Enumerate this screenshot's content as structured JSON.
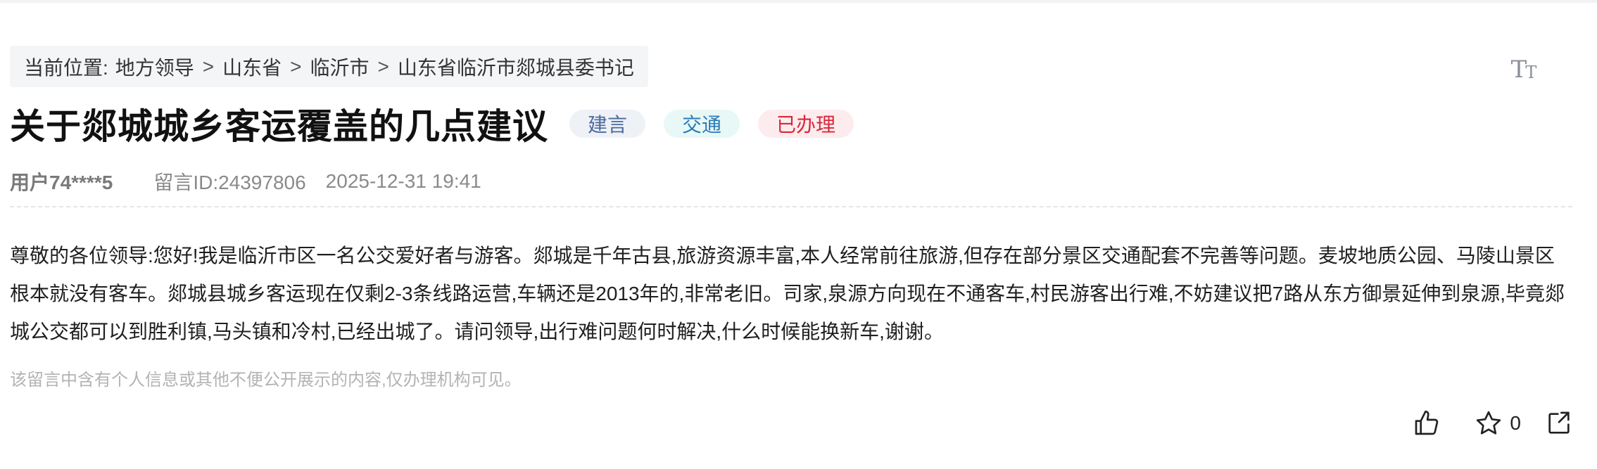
{
  "breadcrumb": {
    "prefix": "当前位置:",
    "items": [
      "地方领导",
      "山东省",
      "临沂市",
      "山东省临沂市郯城县委书记"
    ],
    "separator": ">"
  },
  "font_size_toggle": {
    "big": "T",
    "small": "T"
  },
  "message": {
    "title": "关于郯城城乡客运覆盖的几点建议",
    "tags": [
      "建言",
      "交通",
      "已办理"
    ],
    "user": "用户74****5",
    "id_text": "留言ID:24397806",
    "time": "2025-12-31 19:41",
    "body": "尊敬的各位领导:您好!我是临沂市区一名公交爱好者与游客。郯城是千年古县,旅游资源丰富,本人经常前往旅游,但存在部分景区交通配套不完善等问题。麦坡地质公园、马陵山景区根本就没有客车。郯城县城乡客运现在仅剩2-3条线路运营,车辆还是2013年的,非常老旧。司家,泉源方向现在不通客车,村民游客出行难,不妨建议把7路从东方御景延伸到泉源,毕竟郯城公交都可以到胜利镇,马头镇和冷村,已经出城了。请问领导,出行难问题何时解决,什么时候能换新车,谢谢。",
    "notice": "该留言中含有个人信息或其他不便公开展示的内容,仅办理机构可见。"
  },
  "actions": {
    "like_icon": "thumbs-up-icon",
    "favorite_icon": "star-icon",
    "favorite_count": "0",
    "share_icon": "share-icon"
  },
  "colors": {
    "tag_suggest": "#4a6a9c",
    "tag_traffic": "#2b7bb8",
    "tag_done": "#d8283b"
  }
}
